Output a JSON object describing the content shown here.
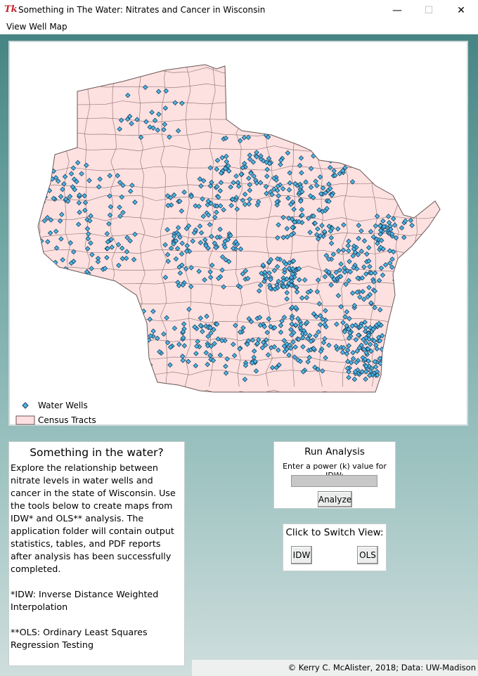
{
  "window": {
    "title": "Something in The Water: Nitrates and Cancer in Wisconsin",
    "logo_text": "Tk",
    "minimize_glyph": "—",
    "maximize_glyph": "☐",
    "close_glyph": "✕"
  },
  "menu": {
    "view_well_map": "View Well Map"
  },
  "map": {
    "legend": {
      "wells": "Water Wells",
      "tracts": "Census Tracts"
    },
    "colors": {
      "tract_fill": "#fde0e0",
      "tract_stroke": "#8a6f6f",
      "well_fill": "#4ab8e8",
      "well_stroke": "#1f3f5a"
    }
  },
  "description": {
    "title": "Something in the water?",
    "body": "Explore the relationship between nitrate levels in water wells and cancer in the state of Wisconsin. Use the tools below to create maps from IDW* and OLS** analysis. The application folder will contain output statistics, tables, and PDF reports after analysis has been successfully completed.",
    "note_idw": "*IDW: Inverse Distance Weighted Interpolation",
    "note_ols": "**OLS: Ordinary Least Squares Regression Testing"
  },
  "analysis": {
    "title": "Run Analysis",
    "prompt": "Enter a power (k) value for IDW:",
    "input_value": "",
    "button": "Analyze"
  },
  "switch_view": {
    "title": "Click to Switch View:",
    "idw": "IDW",
    "ols": "OLS"
  },
  "footer": "© Kerry C. McAlister, 2018; Data: UW-Madison"
}
